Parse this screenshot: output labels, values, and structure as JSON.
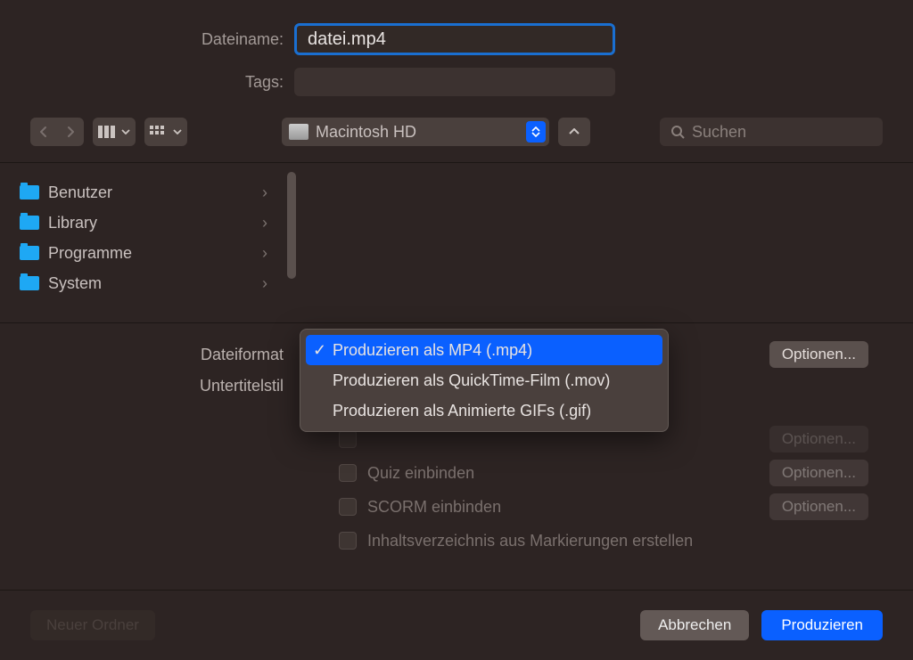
{
  "labels": {
    "filename": "Dateiname:",
    "tags": "Tags:",
    "fileformat": "Dateiformat",
    "subtitle_style": "Untertitelstil"
  },
  "filename": {
    "value": "datei.mp4"
  },
  "location": {
    "name": "Macintosh HD"
  },
  "search": {
    "placeholder": "Suchen"
  },
  "folders": [
    {
      "name": "Benutzer"
    },
    {
      "name": "Library"
    },
    {
      "name": "Programme"
    },
    {
      "name": "System"
    }
  ],
  "options_button": "Optionen...",
  "checkboxes": {
    "quiz": "Quiz einbinden",
    "scorm": "SCORM einbinden",
    "toc": "Inhaltsverzeichnis aus Markierungen erstellen"
  },
  "format_dropdown": [
    "Produzieren als MP4 (.mp4)",
    "Produzieren als QuickTime-Film (.mov)",
    "Produzieren als Animierte GIFs (.gif)"
  ],
  "buttons": {
    "new_folder": "Neuer Ordner",
    "cancel": "Abbrechen",
    "produce": "Produzieren"
  }
}
